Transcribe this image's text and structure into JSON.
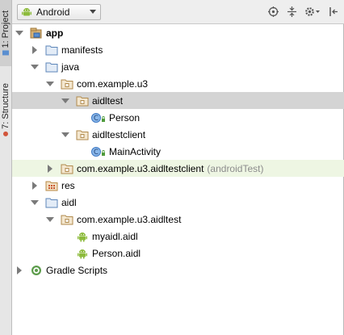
{
  "side_tabs": {
    "project": "1: Project",
    "structure": "7: Structure"
  },
  "toolbar": {
    "view_selector": "Android",
    "icons": [
      "target-icon",
      "collapse-all-icon",
      "settings-icon",
      "hide-icon"
    ]
  },
  "tree": [
    {
      "label": "app",
      "indent": 0,
      "arrow": "down",
      "icon": "module-icon",
      "bold": true
    },
    {
      "label": "manifests",
      "indent": 1,
      "arrow": "right",
      "icon": "folder-icon"
    },
    {
      "label": "java",
      "indent": 1,
      "arrow": "down",
      "icon": "folder-icon"
    },
    {
      "label": "com.example.u3",
      "indent": 2,
      "arrow": "down",
      "icon": "package-icon"
    },
    {
      "label": "aidltest",
      "indent": 3,
      "arrow": "down",
      "icon": "package-icon",
      "selected": true
    },
    {
      "label": "Person",
      "indent": 4,
      "arrow": "none",
      "icon": "class-icon"
    },
    {
      "label": "aidltestclient",
      "indent": 3,
      "arrow": "down",
      "icon": "package-icon"
    },
    {
      "label": "MainActivity",
      "indent": 4,
      "arrow": "none",
      "icon": "class-icon"
    },
    {
      "label": "com.example.u3.aidltestclient",
      "suffix": "(androidTest)",
      "indent": 2,
      "arrow": "right",
      "icon": "package-icon",
      "highlight": true
    },
    {
      "label": "res",
      "indent": 1,
      "arrow": "right",
      "icon": "res-folder-icon"
    },
    {
      "label": "aidl",
      "indent": 1,
      "arrow": "down",
      "icon": "folder-icon"
    },
    {
      "label": "com.example.u3.aidltest",
      "indent": 2,
      "arrow": "down",
      "icon": "package-icon"
    },
    {
      "label": "myaidl.aidl",
      "indent": 3,
      "arrow": "none",
      "icon": "android-icon"
    },
    {
      "label": "Person.aidl",
      "indent": 3,
      "arrow": "none",
      "icon": "android-icon"
    },
    {
      "label": "Gradle Scripts",
      "indent": 0,
      "arrow": "right",
      "icon": "gradle-icon"
    }
  ]
}
